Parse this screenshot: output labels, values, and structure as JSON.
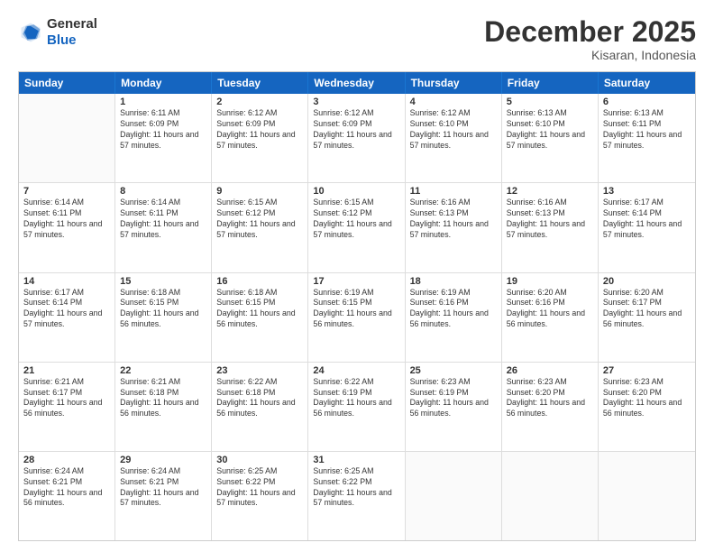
{
  "header": {
    "logo_general": "General",
    "logo_blue": "Blue",
    "month_title": "December 2025",
    "location": "Kisaran, Indonesia"
  },
  "weekdays": [
    "Sunday",
    "Monday",
    "Tuesday",
    "Wednesday",
    "Thursday",
    "Friday",
    "Saturday"
  ],
  "rows": [
    [
      {
        "day": "",
        "sunrise": "",
        "sunset": "",
        "daylight": ""
      },
      {
        "day": "1",
        "sunrise": "Sunrise: 6:11 AM",
        "sunset": "Sunset: 6:09 PM",
        "daylight": "Daylight: 11 hours and 57 minutes."
      },
      {
        "day": "2",
        "sunrise": "Sunrise: 6:12 AM",
        "sunset": "Sunset: 6:09 PM",
        "daylight": "Daylight: 11 hours and 57 minutes."
      },
      {
        "day": "3",
        "sunrise": "Sunrise: 6:12 AM",
        "sunset": "Sunset: 6:09 PM",
        "daylight": "Daylight: 11 hours and 57 minutes."
      },
      {
        "day": "4",
        "sunrise": "Sunrise: 6:12 AM",
        "sunset": "Sunset: 6:10 PM",
        "daylight": "Daylight: 11 hours and 57 minutes."
      },
      {
        "day": "5",
        "sunrise": "Sunrise: 6:13 AM",
        "sunset": "Sunset: 6:10 PM",
        "daylight": "Daylight: 11 hours and 57 minutes."
      },
      {
        "day": "6",
        "sunrise": "Sunrise: 6:13 AM",
        "sunset": "Sunset: 6:11 PM",
        "daylight": "Daylight: 11 hours and 57 minutes."
      }
    ],
    [
      {
        "day": "7",
        "sunrise": "Sunrise: 6:14 AM",
        "sunset": "Sunset: 6:11 PM",
        "daylight": "Daylight: 11 hours and 57 minutes."
      },
      {
        "day": "8",
        "sunrise": "Sunrise: 6:14 AM",
        "sunset": "Sunset: 6:11 PM",
        "daylight": "Daylight: 11 hours and 57 minutes."
      },
      {
        "day": "9",
        "sunrise": "Sunrise: 6:15 AM",
        "sunset": "Sunset: 6:12 PM",
        "daylight": "Daylight: 11 hours and 57 minutes."
      },
      {
        "day": "10",
        "sunrise": "Sunrise: 6:15 AM",
        "sunset": "Sunset: 6:12 PM",
        "daylight": "Daylight: 11 hours and 57 minutes."
      },
      {
        "day": "11",
        "sunrise": "Sunrise: 6:16 AM",
        "sunset": "Sunset: 6:13 PM",
        "daylight": "Daylight: 11 hours and 57 minutes."
      },
      {
        "day": "12",
        "sunrise": "Sunrise: 6:16 AM",
        "sunset": "Sunset: 6:13 PM",
        "daylight": "Daylight: 11 hours and 57 minutes."
      },
      {
        "day": "13",
        "sunrise": "Sunrise: 6:17 AM",
        "sunset": "Sunset: 6:14 PM",
        "daylight": "Daylight: 11 hours and 57 minutes."
      }
    ],
    [
      {
        "day": "14",
        "sunrise": "Sunrise: 6:17 AM",
        "sunset": "Sunset: 6:14 PM",
        "daylight": "Daylight: 11 hours and 57 minutes."
      },
      {
        "day": "15",
        "sunrise": "Sunrise: 6:18 AM",
        "sunset": "Sunset: 6:15 PM",
        "daylight": "Daylight: 11 hours and 56 minutes."
      },
      {
        "day": "16",
        "sunrise": "Sunrise: 6:18 AM",
        "sunset": "Sunset: 6:15 PM",
        "daylight": "Daylight: 11 hours and 56 minutes."
      },
      {
        "day": "17",
        "sunrise": "Sunrise: 6:19 AM",
        "sunset": "Sunset: 6:15 PM",
        "daylight": "Daylight: 11 hours and 56 minutes."
      },
      {
        "day": "18",
        "sunrise": "Sunrise: 6:19 AM",
        "sunset": "Sunset: 6:16 PM",
        "daylight": "Daylight: 11 hours and 56 minutes."
      },
      {
        "day": "19",
        "sunrise": "Sunrise: 6:20 AM",
        "sunset": "Sunset: 6:16 PM",
        "daylight": "Daylight: 11 hours and 56 minutes."
      },
      {
        "day": "20",
        "sunrise": "Sunrise: 6:20 AM",
        "sunset": "Sunset: 6:17 PM",
        "daylight": "Daylight: 11 hours and 56 minutes."
      }
    ],
    [
      {
        "day": "21",
        "sunrise": "Sunrise: 6:21 AM",
        "sunset": "Sunset: 6:17 PM",
        "daylight": "Daylight: 11 hours and 56 minutes."
      },
      {
        "day": "22",
        "sunrise": "Sunrise: 6:21 AM",
        "sunset": "Sunset: 6:18 PM",
        "daylight": "Daylight: 11 hours and 56 minutes."
      },
      {
        "day": "23",
        "sunrise": "Sunrise: 6:22 AM",
        "sunset": "Sunset: 6:18 PM",
        "daylight": "Daylight: 11 hours and 56 minutes."
      },
      {
        "day": "24",
        "sunrise": "Sunrise: 6:22 AM",
        "sunset": "Sunset: 6:19 PM",
        "daylight": "Daylight: 11 hours and 56 minutes."
      },
      {
        "day": "25",
        "sunrise": "Sunrise: 6:23 AM",
        "sunset": "Sunset: 6:19 PM",
        "daylight": "Daylight: 11 hours and 56 minutes."
      },
      {
        "day": "26",
        "sunrise": "Sunrise: 6:23 AM",
        "sunset": "Sunset: 6:20 PM",
        "daylight": "Daylight: 11 hours and 56 minutes."
      },
      {
        "day": "27",
        "sunrise": "Sunrise: 6:23 AM",
        "sunset": "Sunset: 6:20 PM",
        "daylight": "Daylight: 11 hours and 56 minutes."
      }
    ],
    [
      {
        "day": "28",
        "sunrise": "Sunrise: 6:24 AM",
        "sunset": "Sunset: 6:21 PM",
        "daylight": "Daylight: 11 hours and 56 minutes."
      },
      {
        "day": "29",
        "sunrise": "Sunrise: 6:24 AM",
        "sunset": "Sunset: 6:21 PM",
        "daylight": "Daylight: 11 hours and 57 minutes."
      },
      {
        "day": "30",
        "sunrise": "Sunrise: 6:25 AM",
        "sunset": "Sunset: 6:22 PM",
        "daylight": "Daylight: 11 hours and 57 minutes."
      },
      {
        "day": "31",
        "sunrise": "Sunrise: 6:25 AM",
        "sunset": "Sunset: 6:22 PM",
        "daylight": "Daylight: 11 hours and 57 minutes."
      },
      {
        "day": "",
        "sunrise": "",
        "sunset": "",
        "daylight": ""
      },
      {
        "day": "",
        "sunrise": "",
        "sunset": "",
        "daylight": ""
      },
      {
        "day": "",
        "sunrise": "",
        "sunset": "",
        "daylight": ""
      }
    ]
  ]
}
